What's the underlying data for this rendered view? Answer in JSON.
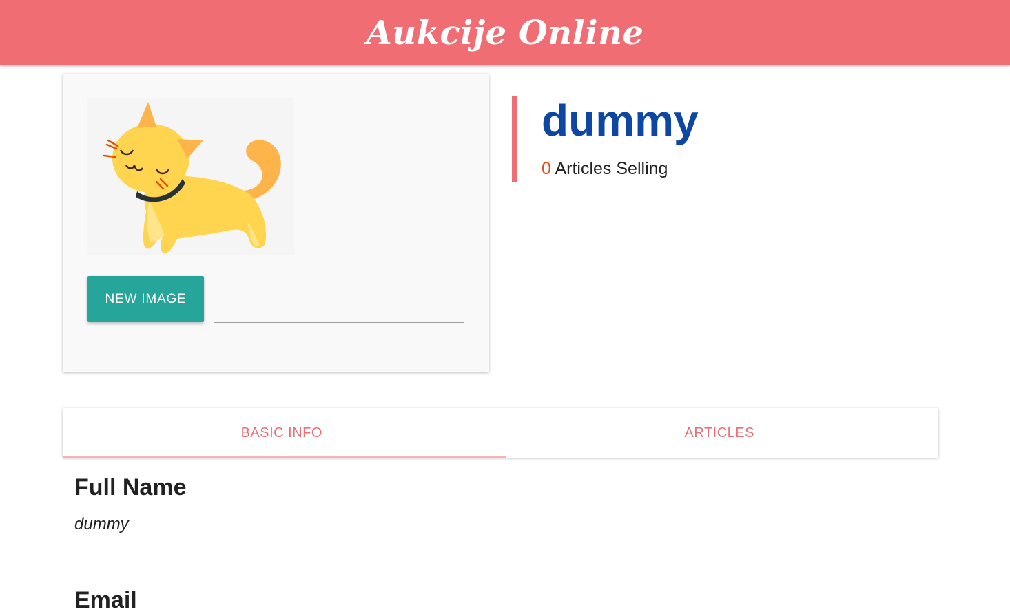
{
  "app": {
    "title": "Aukcije Online",
    "brand_color": "#f06d74"
  },
  "profile": {
    "username": "dummy",
    "articles_count": "0",
    "articles_label": " Articles Selling",
    "avatar_icon": "cat-illustration",
    "new_image_label": "NEW IMAGE",
    "file_path_value": ""
  },
  "tabs": [
    {
      "label": "BASIC INFO",
      "active": true
    },
    {
      "label": "ARTICLES",
      "active": false
    }
  ],
  "basic_info": {
    "fields": [
      {
        "label": "Full Name",
        "value": "dummy"
      },
      {
        "label": "Email",
        "value": ""
      }
    ]
  },
  "colors": {
    "button": "#26a69a",
    "username": "#0d47a1",
    "count": "#e64a19",
    "tab_text": "#ee6e73"
  }
}
